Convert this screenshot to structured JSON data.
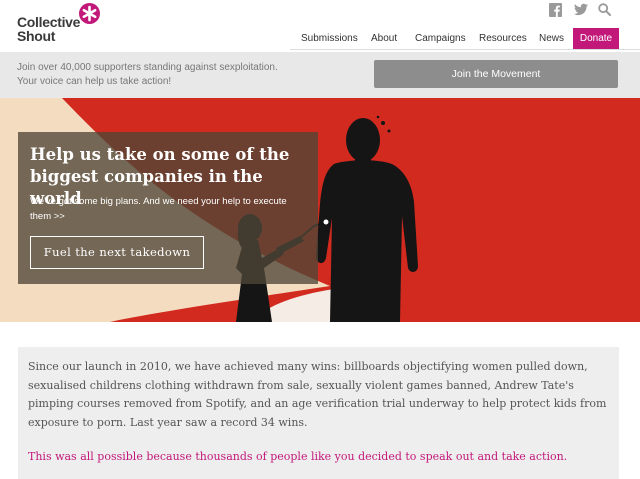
{
  "brand": {
    "name_line1": "Collective",
    "name_line2": "Shout",
    "accent_color": "#c2187a"
  },
  "social": {
    "icons": [
      "facebook-icon",
      "twitter-icon",
      "search-icon"
    ]
  },
  "nav": {
    "items": [
      "Submissions",
      "About",
      "Campaigns",
      "Resources",
      "News"
    ],
    "donate_label": "Donate"
  },
  "joinbar": {
    "text": "Join over 40,000 supporters standing against sexploitation. Your voice can help us take action!",
    "button_label": "Join the Movement"
  },
  "hero": {
    "title": "Help us take on some of the biggest companies in the world",
    "subtitle": "We've got some big plans. And we need your help to execute them >>",
    "cta_label": "Fuel the next takedown"
  },
  "intro": {
    "text": "Since our launch in 2010, we have achieved many wins: billboards objectifying women pulled down, sexualised childrens clothing withdrawn from sale, sexually violent games banned, Andrew Tate's pimping courses removed from Spotify, and an age verification trial underway to help protect kids from exposure to porn. Last year saw a record 34 wins.",
    "highlight": "This was all possible because thousands of people like you decided to speak out and take action."
  }
}
